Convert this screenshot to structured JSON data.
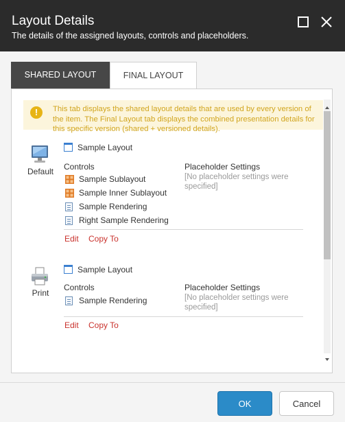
{
  "dialog": {
    "title": "Layout Details",
    "subtitle": "The details of the assigned layouts, controls and placeholders."
  },
  "window_controls": [
    "maximize-icon",
    "close-icon"
  ],
  "tabs": [
    {
      "label": "SHARED LAYOUT",
      "active": true
    },
    {
      "label": "FINAL LAYOUT",
      "active": false
    }
  ],
  "notice": {
    "icon": "warning-icon",
    "icon_glyph": "!",
    "text": "This tab displays the shared layout details that are used by every version of the item. The Final Layout tab displays the combined presentation details for this specific version (shared + versioned details)."
  },
  "devices": [
    {
      "name": "Default",
      "icon": "monitor-icon",
      "layout": "Sample Layout",
      "controls_header": "Controls",
      "controls": [
        {
          "label": "Sample Sublayout",
          "icon": "sublayout-icon"
        },
        {
          "label": "Sample Inner Sublayout",
          "icon": "sublayout-icon"
        },
        {
          "label": "Sample Rendering",
          "icon": "rendering-icon"
        },
        {
          "label": "Right Sample Rendering",
          "icon": "rendering-icon"
        }
      ],
      "placeholders_header": "Placeholder Settings",
      "placeholders_empty": "[No placeholder settings were specified]",
      "edit_label": "Edit",
      "copy_label": "Copy To"
    },
    {
      "name": "Print",
      "icon": "printer-icon",
      "layout": "Sample Layout",
      "controls_header": "Controls",
      "controls": [
        {
          "label": "Sample Rendering",
          "icon": "rendering-icon"
        }
      ],
      "placeholders_header": "Placeholder Settings",
      "placeholders_empty": "[No placeholder settings were specified]",
      "edit_label": "Edit",
      "copy_label": "Copy To"
    }
  ],
  "footer": {
    "ok_label": "OK",
    "cancel_label": "Cancel"
  },
  "colors": {
    "titlebar": "#2b2b2b",
    "active_tab": "#474747",
    "notice_bg": "#fcf5dc",
    "notice_text": "#d1a51e",
    "link": "#c9312c",
    "primary_button": "#2b8bc8"
  }
}
